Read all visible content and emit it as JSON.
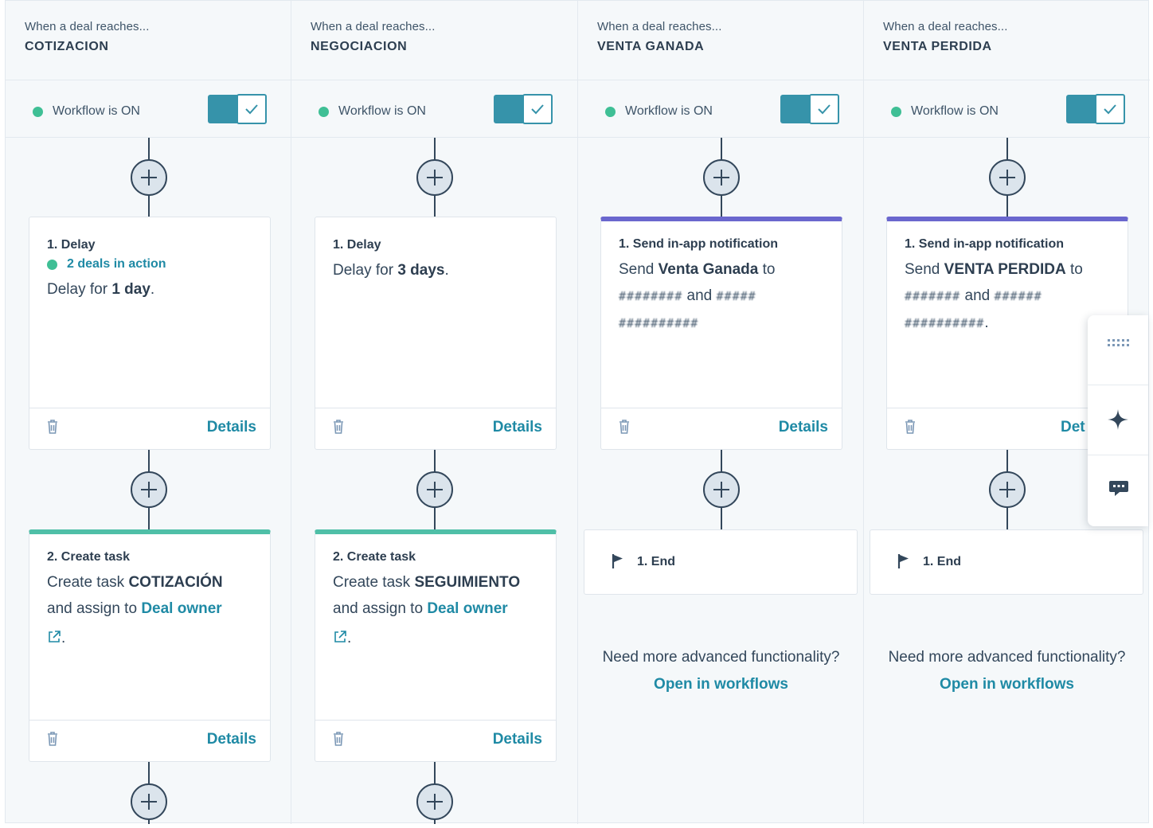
{
  "columns": [
    {
      "header": {
        "subtitle": "When a deal reaches...",
        "stage": "COTIZACION"
      },
      "workflow_status": "Workflow is ON",
      "cards": [
        {
          "title": "1. Delay",
          "in_action": "2 deals in action",
          "line_prefix": "Delay for ",
          "line_value": "1 day",
          "line_suffix": ".",
          "details_label": "Details"
        },
        {
          "title": "2. Create task",
          "line1_prefix": "Create task ",
          "line1_value": "COTIZACIÓN",
          "line2_prefix": "and assign to ",
          "line2_link": "Deal owner",
          "line3_suffix": ".",
          "details_label": "Details"
        }
      ]
    },
    {
      "header": {
        "subtitle": "When a deal reaches...",
        "stage": "NEGOCIACION"
      },
      "workflow_status": "Workflow is ON",
      "cards": [
        {
          "title": "1. Delay",
          "line_prefix": "Delay for ",
          "line_value": "3 days",
          "line_suffix": ".",
          "details_label": "Details"
        },
        {
          "title": "2. Create task",
          "line1_prefix": "Create task ",
          "line1_value": "SEGUIMIENTO",
          "line2_prefix": "and assign to ",
          "line2_link": "Deal owner",
          "line3_suffix": ".",
          "details_label": "Details"
        }
      ]
    },
    {
      "header": {
        "subtitle": "When a deal reaches...",
        "stage": "VENTA GANADA"
      },
      "workflow_status": "Workflow is ON",
      "cards": [
        {
          "title": "1. Send in-app notification",
          "line1_prefix": "Send ",
          "line1_value": "Venta Ganada",
          "line1_suffix": " to",
          "line2_blur_a": "########",
          "line2_mid": " and ",
          "line2_blur_b": "#####",
          "line3_blur": "##########",
          "details_label": "Details"
        }
      ],
      "end_label": "1. End",
      "advanced_text": "Need more advanced functionality?",
      "advanced_link": "Open in workflows"
    },
    {
      "header": {
        "subtitle": "When a deal reaches...",
        "stage": "VENTA PERDIDA"
      },
      "workflow_status": "Workflow is ON",
      "cards": [
        {
          "title": "1. Send in-app notification",
          "line1_prefix": "Send ",
          "line1_value": "VENTA PERDIDA",
          "line1_suffix": " to",
          "line2_blur_a": "#######",
          "line2_mid": " and ",
          "line2_blur_b": "######",
          "line3_blur": "##########",
          "line3_suffix": ".",
          "details_label": "Det"
        }
      ],
      "end_label": "1. End",
      "advanced_text": "Need more advanced functionality?",
      "advanced_link": "Open in workflows"
    }
  ],
  "side_panel": {
    "icons": [
      "grid-icon",
      "sparkle-icon",
      "chat-icon"
    ]
  },
  "colors": {
    "accent_teal": "#1f8aa5",
    "toggle": "#3693aa",
    "status_green": "#3fbf95",
    "notification_accent": "#6a67ce",
    "task_accent": "#4fbfa7",
    "text_dark": "#2d3e50"
  }
}
